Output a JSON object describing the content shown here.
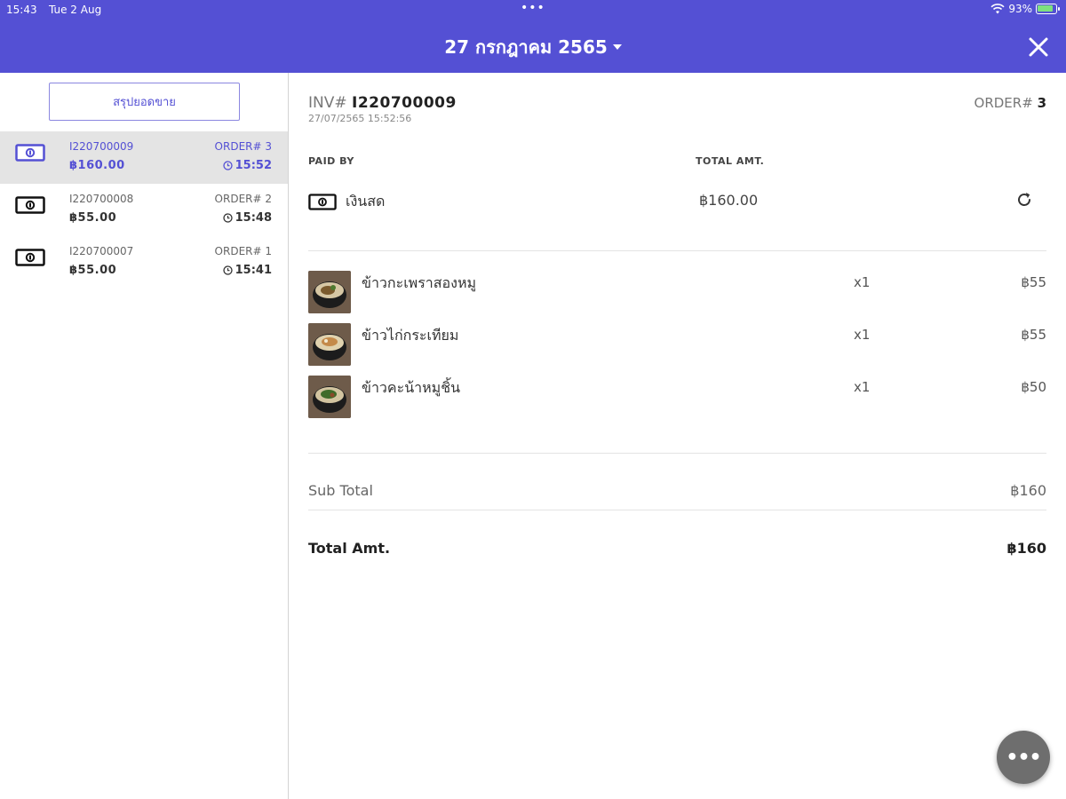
{
  "status_bar": {
    "time": "15:43",
    "date": "Tue 2 Aug",
    "dots": "•••",
    "battery": "93%"
  },
  "header": {
    "title": "27 กรกฎาคม 2565",
    "close_icon": "close-icon",
    "color": "#5450d4"
  },
  "sidebar": {
    "summary_button": "สรุปยอดขาย",
    "orders": [
      {
        "invoice": "I220700009",
        "amount": "฿160.00",
        "order": "ORDER# 3",
        "time": "15:52",
        "selected": true
      },
      {
        "invoice": "I220700008",
        "amount": "฿55.00",
        "order": "ORDER# 2",
        "time": "15:48",
        "selected": false
      },
      {
        "invoice": "I220700007",
        "amount": "฿55.00",
        "order": "ORDER# 1",
        "time": "15:41",
        "selected": false
      }
    ]
  },
  "detail": {
    "inv_prefix": "INV#",
    "inv_no": "I220700009",
    "datetime": "27/07/2565 15:52:56",
    "order_prefix": "ORDER#",
    "order_no": "3",
    "paid_by_label": "PAID BY",
    "total_amt_label": "TOTAL AMT.",
    "payment_method": "เงินสด",
    "payment_amount": "฿160.00",
    "items": [
      {
        "name": "ข้าวกะเพราสองหมู",
        "qty": "x1",
        "price": "฿55"
      },
      {
        "name": "ข้าวไก่กระเทียม",
        "qty": "x1",
        "price": "฿55"
      },
      {
        "name": "ข้าวคะน้าหมูชิ้น",
        "qty": "x1",
        "price": "฿50"
      }
    ],
    "subtotal_label": "Sub Total",
    "subtotal_value": "฿160",
    "total_label": "Total Amt.",
    "total_value": "฿160"
  },
  "fab": {
    "label": "•••",
    "icon": "more-icon"
  }
}
